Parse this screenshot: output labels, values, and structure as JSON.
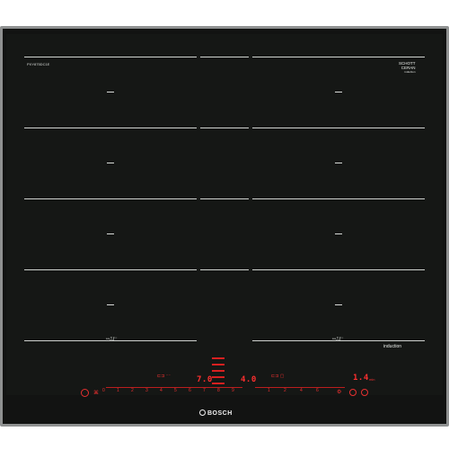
{
  "hob": {
    "model_code": "PXY875DC1E",
    "brand_mark": {
      "line1": "SCHOTT",
      "line2": "CERAN",
      "line3": "induction"
    },
    "zone_label": "induction",
    "flex_label": "ꟷ⎍∫⁻⁻",
    "logo_text": "BOSCH"
  },
  "display": {
    "left_power": "7.0",
    "center_power": "4.0",
    "right_power": "1.4",
    "right_unit": "min"
  },
  "scale": {
    "marks": [
      "0",
      "1",
      "2",
      "3",
      "4",
      "5",
      "6",
      "7",
      "8",
      "9"
    ]
  }
}
